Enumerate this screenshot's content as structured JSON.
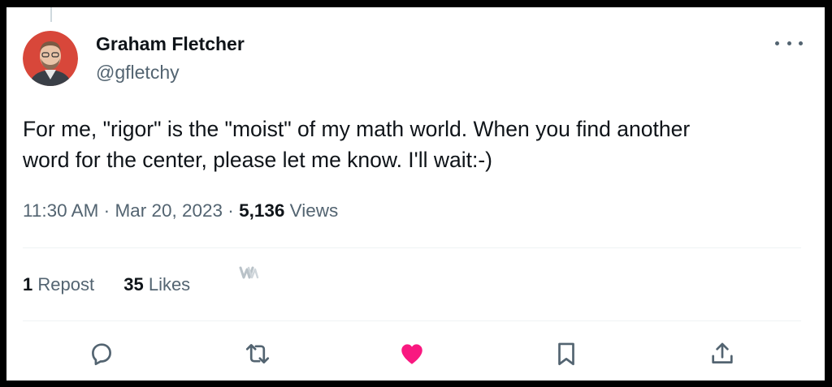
{
  "author": {
    "name": "Graham Fletcher",
    "handle": "@gfletchy"
  },
  "tweet": {
    "lines": [
      "For me, \"rigor\" is the \"moist\" of my math world. When you find another",
      "word for the center, please let me know. I'll wait:-)"
    ]
  },
  "meta": {
    "time": "11:30 AM",
    "separator": "·",
    "date": "Mar 20, 2023",
    "views_count": "5,136",
    "views_label": "Views"
  },
  "stats": {
    "reposts_count": "1",
    "reposts_label": "Repost",
    "likes_count": "35",
    "likes_label": "Likes"
  },
  "actions": {
    "like_color": "#f91880",
    "icon_color": "#536471",
    "icons": [
      "reply-icon",
      "repost-icon",
      "like-icon",
      "bookmark-icon",
      "share-icon"
    ]
  },
  "avatar": {
    "background_color": "#d8473a"
  }
}
